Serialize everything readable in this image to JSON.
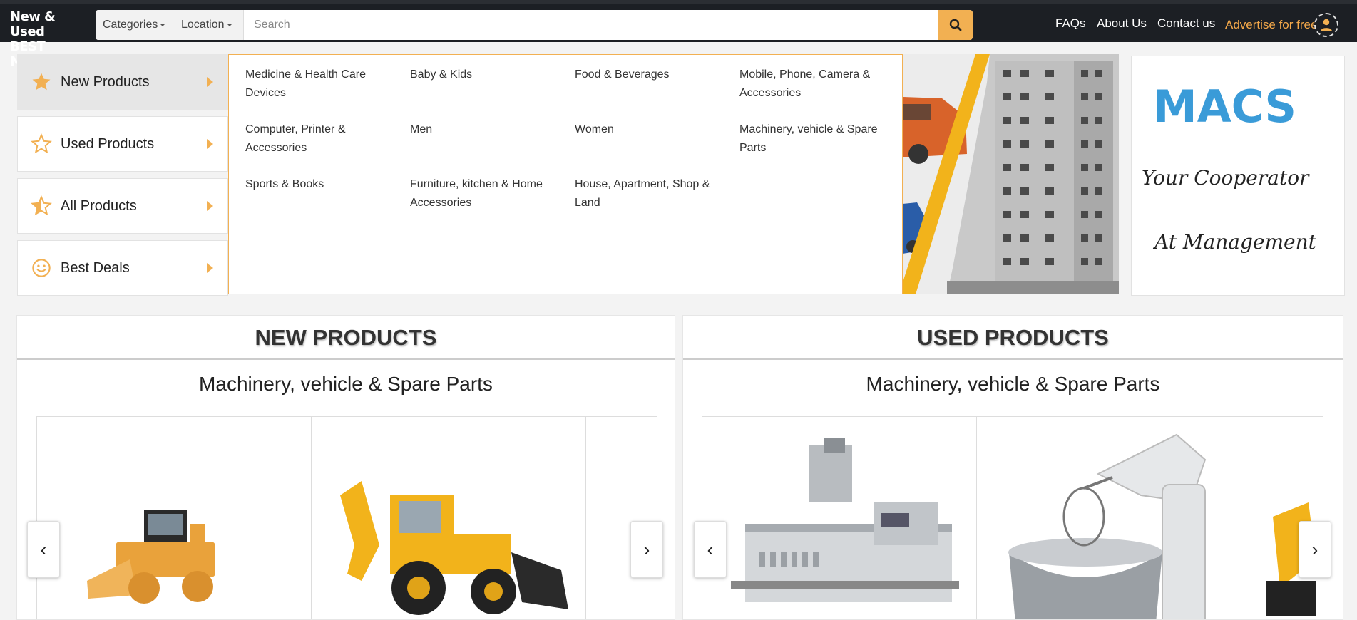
{
  "header": {
    "logo_line1": "New & Used",
    "logo_line2": "BEST MART",
    "categories_label": "Categories",
    "location_label": "Location",
    "search_placeholder": "Search",
    "nav": {
      "faqs": "FAQs",
      "about": "About Us",
      "contact": "Contact us",
      "advertise": "Advertise for free"
    }
  },
  "sidebar": {
    "items": [
      {
        "label": "New Products",
        "icon": "star-filled-icon"
      },
      {
        "label": "Used Products",
        "icon": "star-outline-icon"
      },
      {
        "label": "All Products",
        "icon": "star-half-icon"
      },
      {
        "label": "Best Deals",
        "icon": "smiley-icon"
      }
    ]
  },
  "mega_menu": {
    "items": [
      "Medicine & Health Care Devices",
      "Baby & Kids",
      "Food & Beverages",
      "Mobile, Phone, Camera & Accessories",
      "Computer, Printer & Accessories",
      "Men",
      "Women",
      "Machinery, vehicle & Spare Parts",
      "Sports & Books",
      "Furniture, kitchen & Home Accessories",
      "House, Apartment, Shop & Land"
    ]
  },
  "banner": {
    "macs_logo": "MACS",
    "tagline1": "Your Cooperator",
    "tagline2": "At Management"
  },
  "new_products": {
    "title": "NEW PRODUCTS",
    "subtitle": "Machinery, vehicle & Spare Parts",
    "prev": "‹",
    "next": "›"
  },
  "used_products": {
    "title": "USED PRODUCTS",
    "subtitle": "Machinery, vehicle & Spare Parts",
    "prev": "‹",
    "next": "›"
  },
  "colors": {
    "accent": "#f2b052",
    "header_bg": "#1c1f24",
    "advertise": "#f5a94a"
  }
}
